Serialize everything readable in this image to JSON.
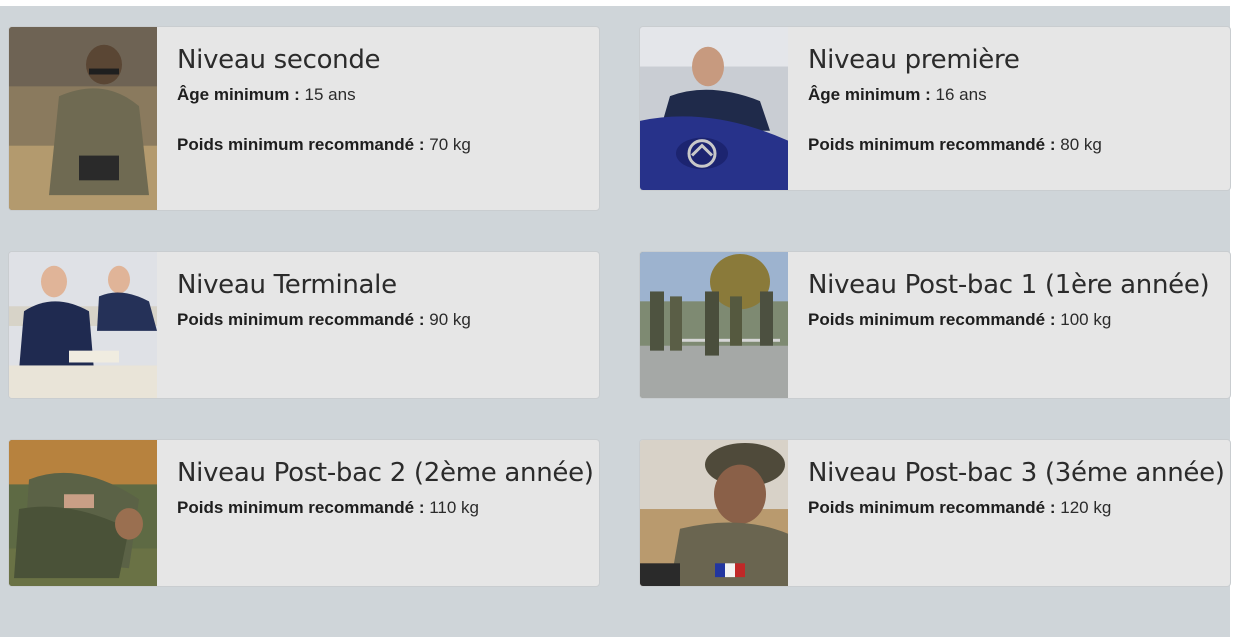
{
  "cards": [
    {
      "title": "Niveau seconde",
      "age_label": "Âge minimum :",
      "age_value": "15 ans",
      "weight_label": "Poids minimum recommandé :",
      "weight_value": "70 kg"
    },
    {
      "title": "Niveau première",
      "age_label": "Âge minimum :",
      "age_value": "16 ans",
      "weight_label": "Poids minimum recommandé :",
      "weight_value": "80 kg"
    },
    {
      "title": "Niveau Terminale",
      "weight_label": "Poids minimum recommandé :",
      "weight_value": "90 kg"
    },
    {
      "title": "Niveau Post-bac 1 (1ère année)",
      "weight_label": "Poids minimum recommandé :",
      "weight_value": "100 kg"
    },
    {
      "title": "Niveau Post-bac 2 (2ème année)",
      "weight_label": "Poids minimum recommandé :",
      "weight_value": "110 kg"
    },
    {
      "title": "Niveau Post-bac 3 (3éme année)",
      "weight_label": "Poids minimum recommandé :",
      "weight_value": "120 kg"
    }
  ],
  "colors": {
    "panel": "#cfd5d9",
    "card": "#e6e6e6",
    "text": "#2b2b2b"
  }
}
